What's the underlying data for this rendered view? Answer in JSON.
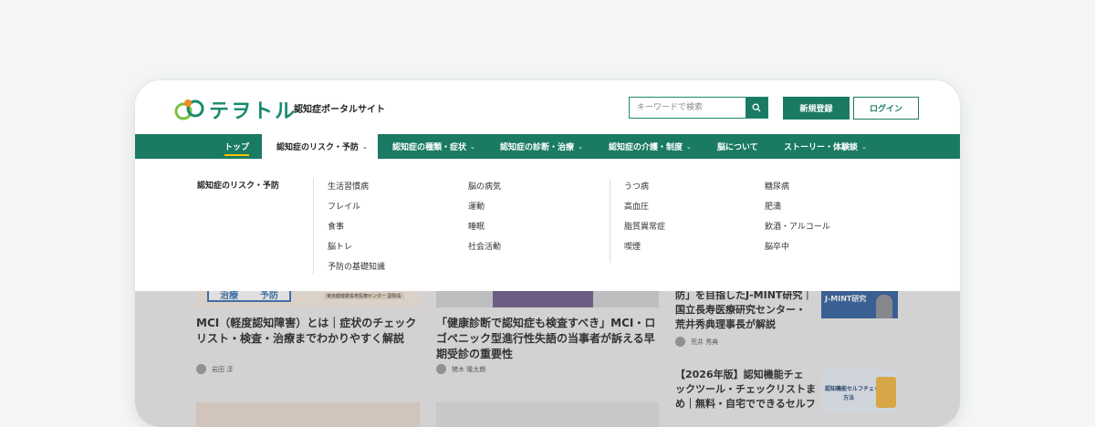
{
  "header": {
    "logo_text": "テヲトル",
    "tagline": "認知症ポータルサイト",
    "search_placeholder": "キーワードで検索",
    "register_label": "新規登録",
    "login_label": "ログイン"
  },
  "nav": {
    "items": [
      {
        "label": "トップ"
      },
      {
        "label": "認知症のリスク・予防"
      },
      {
        "label": "認知症の種類・症状"
      },
      {
        "label": "認知症の診断・治療"
      },
      {
        "label": "認知症の介護・制度"
      },
      {
        "label": "脳について"
      },
      {
        "label": "ストーリー・体験談"
      }
    ]
  },
  "megamenu": {
    "title": "認知症のリスク・予防",
    "col1": [
      "生活習慣病",
      "フレイル",
      "食事",
      "脳トレ",
      "予防の基礎知識"
    ],
    "col2": [
      "脳の病気",
      "運動",
      "睡眠",
      "社会活動"
    ],
    "col3": [
      "うつ病",
      "高血圧",
      "脂質異常症",
      "喫煙"
    ],
    "col4": [
      "糖尿病",
      "肥満",
      "飲酒・アルコール",
      "脳卒中"
    ]
  },
  "articles": {
    "a1": {
      "title_line1": "MCI（軽度認知障害）とは｜症状のチェック",
      "title_line2": "リスト・検査・治療までわかりやすく解説",
      "author": "岩田 淳",
      "thumb_text1": "治療",
      "thumb_text2": "予防",
      "thumb_caption": "東京都健康長寿医療センター 副院長"
    },
    "a2": {
      "title_line1": "「健康診断で認知症も検査すべき」MCI・ロ",
      "title_line2": "ゴペニック型進行性失語の当事者が訴える早",
      "title_line3": "期受診の重要性",
      "author": "猪木 隆太朗"
    },
    "a3": {
      "title_line1": "防」を目指したJ-MINT研究｜",
      "title_line2": "国立長寿医療研究センター・",
      "title_line3": "荒井秀典理事長が解説",
      "author": "荒井 秀典",
      "thumb_text": "J-MINT研究"
    },
    "a4": {
      "title_line1": "【2026年版】認知機能チェ",
      "title_line2": "ックツール・チェックリストま",
      "title_line3": "と",
      "title_line4": "め｜無料・自宅でできるセルフ",
      "thumb_text": "認知機能セルフチェックの",
      "thumb_text2": "方法"
    }
  },
  "colors": {
    "brand": "#1a7a63",
    "accent": "#f5c400"
  }
}
